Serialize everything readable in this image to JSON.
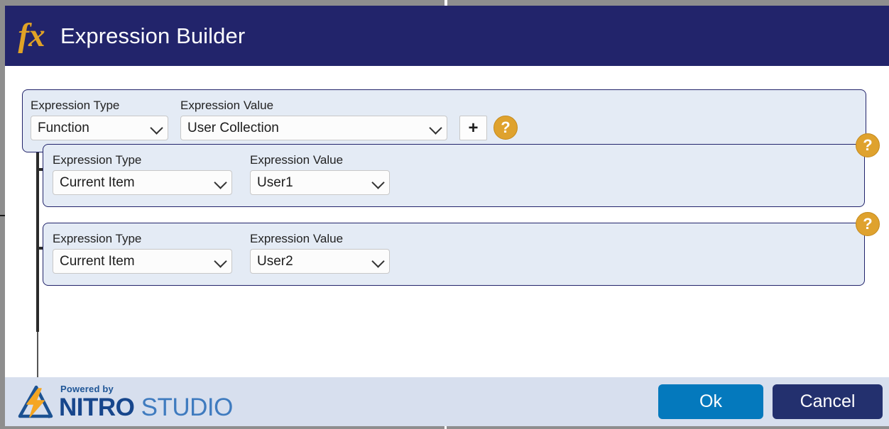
{
  "window": {
    "title": "Expression Builder",
    "logo_glyph": "fx",
    "logo_icon_name": "fx-icon",
    "header_bg": "#22246b",
    "accent_orange": "#dfa22e"
  },
  "builder": {
    "labels": {
      "expression_type": "Expression Type",
      "expression_value": "Expression Value"
    },
    "root_node": {
      "expression_type": "Function",
      "expression_value": "User Collection",
      "add_label": "+",
      "help_label": "?"
    },
    "child_nodes": [
      {
        "expression_type": "Current Item",
        "expression_value": "User1",
        "help_label": "?"
      },
      {
        "expression_type": "Current Item",
        "expression_value": "User2",
        "help_label": "?"
      }
    ]
  },
  "footer": {
    "powered_by": "Powered by",
    "brand_primary": "NITRO",
    "brand_secondary": " STUDIO",
    "ok_label": "Ok",
    "cancel_label": "Cancel",
    "bar_color": "#d7dfee",
    "ok_color": "#0479bd",
    "cancel_color": "#23306e"
  }
}
